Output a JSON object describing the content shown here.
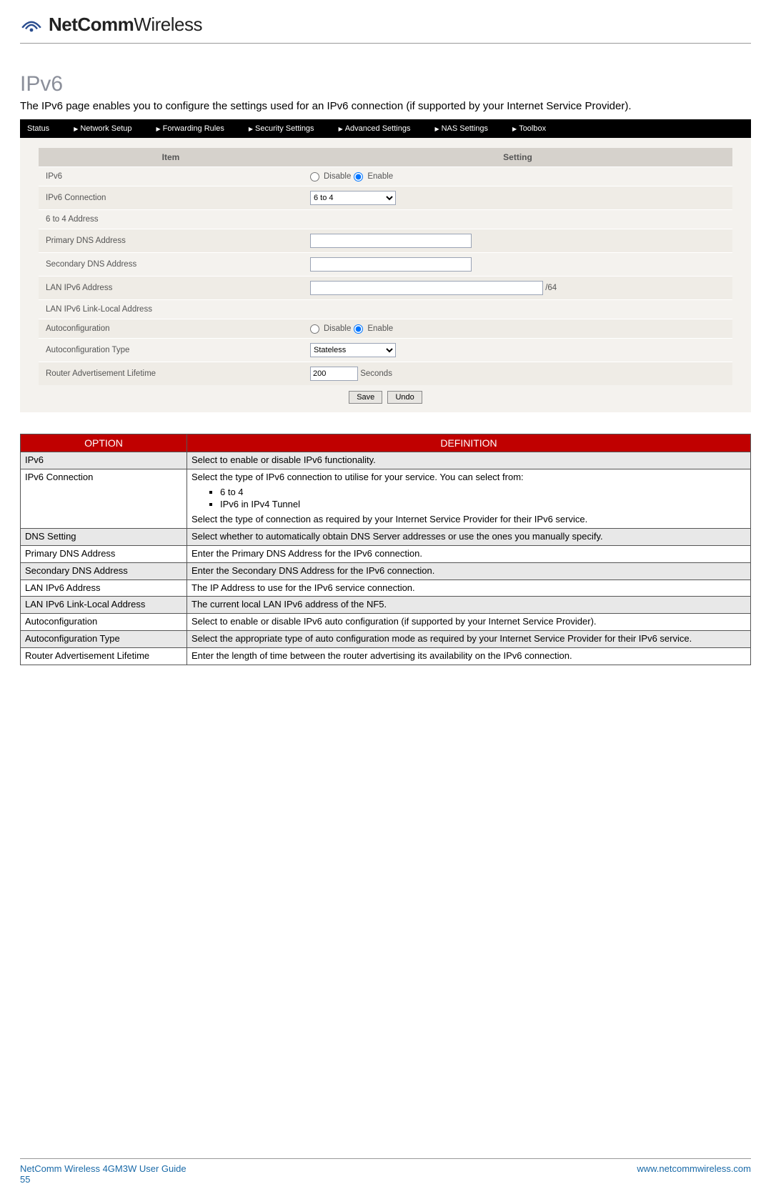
{
  "logo": {
    "bold": "NetComm",
    "light": "Wireless"
  },
  "section": {
    "title": "IPv6",
    "intro": "The IPv6 page enables you to configure the settings used for an IPv6 connection (if supported by your Internet Service Provider)."
  },
  "nav": {
    "items": [
      {
        "label": "Status",
        "caret": false
      },
      {
        "label": "Network Setup",
        "caret": true
      },
      {
        "label": "Forwarding Rules",
        "caret": true
      },
      {
        "label": "Security Settings",
        "caret": true
      },
      {
        "label": "Advanced Settings",
        "caret": true
      },
      {
        "label": "NAS Settings",
        "caret": true
      },
      {
        "label": "Toolbox",
        "caret": true
      }
    ]
  },
  "settings_table": {
    "headers": {
      "item": "Item",
      "setting": "Setting"
    },
    "rows": {
      "ipv6": "IPv6",
      "ipv6_radio": {
        "disable": "Disable",
        "enable": "Enable"
      },
      "ipv6_connection": "IPv6 Connection",
      "ipv6_connection_value": "6 to 4",
      "six_to_four_address": "6 to 4 Address",
      "primary_dns": "Primary DNS Address",
      "secondary_dns": "Secondary DNS Address",
      "lan_ipv6": "LAN IPv6 Address",
      "lan_ipv6_suffix": "/64",
      "lan_ipv6_link_local": "LAN IPv6 Link-Local Address",
      "autoconfig": "Autoconfiguration",
      "autoconfig_radio": {
        "disable": "Disable",
        "enable": "Enable"
      },
      "autoconfig_type": "Autoconfiguration Type",
      "autoconfig_type_value": "Stateless",
      "ra_lifetime": "Router Advertisement Lifetime",
      "ra_lifetime_value": "200",
      "ra_lifetime_unit": "Seconds"
    },
    "buttons": {
      "save": "Save",
      "undo": "Undo"
    }
  },
  "def_table": {
    "headers": {
      "option": "OPTION",
      "definition": "DEFINITION"
    },
    "rows": [
      {
        "shade": true,
        "opt": "IPv6",
        "def": "Select to enable or disable IPv6 functionality."
      },
      {
        "shade": false,
        "opt": "IPv6 Connection",
        "def_intro": "Select the type of IPv6 connection to utilise for your service. You can select from:",
        "bullets": [
          "6 to 4",
          "IPv6 in IPv4 Tunnel"
        ],
        "def_outro": "Select the type of connection as required by your Internet Service Provider for their IPv6 service."
      },
      {
        "shade": true,
        "opt": "DNS Setting",
        "def": "Select whether to automatically obtain DNS Server addresses or use the ones you manually specify."
      },
      {
        "shade": false,
        "opt": "Primary DNS Address",
        "def": "Enter the Primary DNS Address for the IPv6 connection."
      },
      {
        "shade": true,
        "opt": "Secondary DNS Address",
        "def": "Enter the Secondary DNS Address for the IPv6 connection."
      },
      {
        "shade": false,
        "opt": "LAN IPv6 Address",
        "def": "The IP Address to use for the IPv6 service connection."
      },
      {
        "shade": true,
        "opt": "LAN IPv6 Link-Local Address",
        "def": "The current local LAN IPv6 address of the NF5."
      },
      {
        "shade": false,
        "opt": "Autoconfiguration",
        "def": "Select to enable or disable IPv6 auto configuration (if supported by your Internet Service Provider)."
      },
      {
        "shade": true,
        "opt": "Autoconfiguration Type",
        "def": "Select the appropriate type of auto configuration mode as required by your Internet Service Provider for their IPv6 service."
      },
      {
        "shade": false,
        "opt": "Router Advertisement Lifetime",
        "def": "Enter the length of time between the router advertising its availability on the IPv6 connection."
      }
    ]
  },
  "footer": {
    "left": "NetComm Wireless 4GM3W User Guide",
    "right": "www.netcommwireless.com",
    "page": "55"
  }
}
